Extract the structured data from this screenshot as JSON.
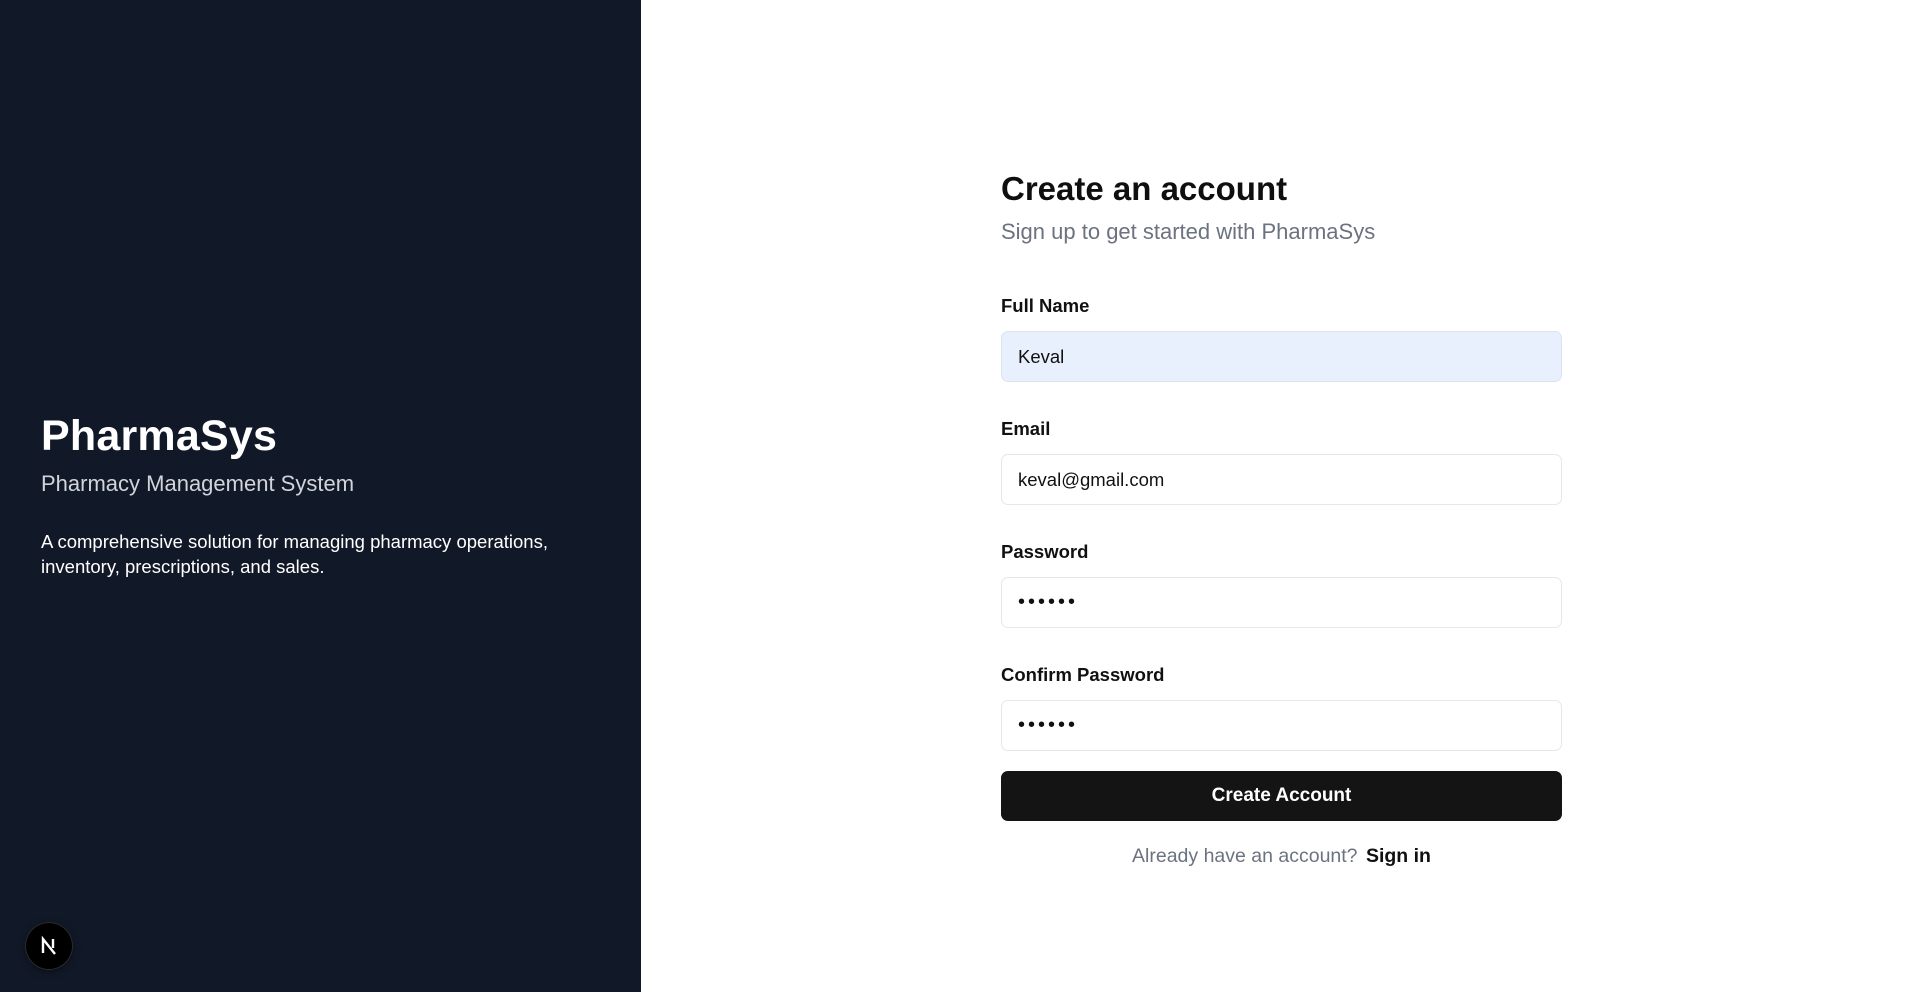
{
  "brand": {
    "title": "PharmaSys",
    "subtitle": "Pharmacy Management System",
    "description": "A comprehensive solution for managing pharmacy operations, inventory, prescriptions, and sales.",
    "background_color": "#111827",
    "devtools_badge_letter": "N"
  },
  "form": {
    "heading": "Create an account",
    "subheading": "Sign up to get started with PharmaSys",
    "fields": {
      "full_name": {
        "label": "Full Name",
        "value": "Keval"
      },
      "email": {
        "label": "Email",
        "value": "keval@gmail.com"
      },
      "password": {
        "label": "Password",
        "value": "••••••"
      },
      "confirm_password": {
        "label": "Confirm Password",
        "value": "••••••"
      }
    },
    "submit_label": "Create Account",
    "signin_prompt": "Already have an account?",
    "signin_link": "Sign in",
    "button_color": "#141414",
    "autofill_color": "#e8f0fe"
  }
}
